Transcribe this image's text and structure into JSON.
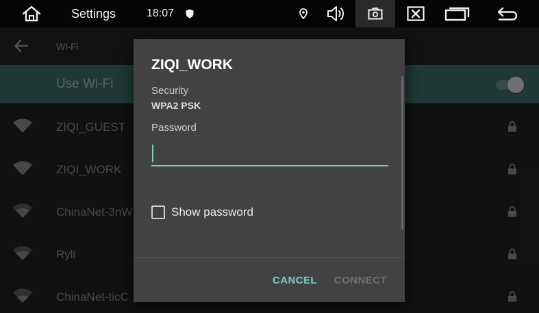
{
  "topbar": {
    "title": "Settings",
    "time": "18:07",
    "icons": [
      "home-icon",
      "shield-icon",
      "location-icon",
      "volume-icon",
      "screenshot-icon",
      "close-window-icon",
      "recents-icon",
      "back-icon"
    ]
  },
  "subheader": {
    "title": "Wi-Fi"
  },
  "use_wifi": {
    "label": "Use Wi-Fi",
    "enabled": true
  },
  "networks": [
    {
      "name": "ZIQI_GUEST",
      "locked": true
    },
    {
      "name": "ZIQI_WORK",
      "locked": true
    },
    {
      "name": "ChinaNet-3nW",
      "locked": true
    },
    {
      "name": "Ryli",
      "locked": true
    },
    {
      "name": "ChinaNet-ticC",
      "locked": true
    }
  ],
  "dialog": {
    "title": "ZIQI_WORK",
    "security_label": "Security",
    "security_value": "WPA2 PSK",
    "password_label": "Password",
    "password_value": "",
    "show_password_label": "Show password",
    "show_password_checked": false,
    "cancel_label": "CANCEL",
    "connect_label": "CONNECT"
  },
  "colors": {
    "accent": "#80cbc4",
    "use_wifi_bar": "#3e6e68",
    "dialog_bg": "#424242",
    "background": "#222222"
  }
}
